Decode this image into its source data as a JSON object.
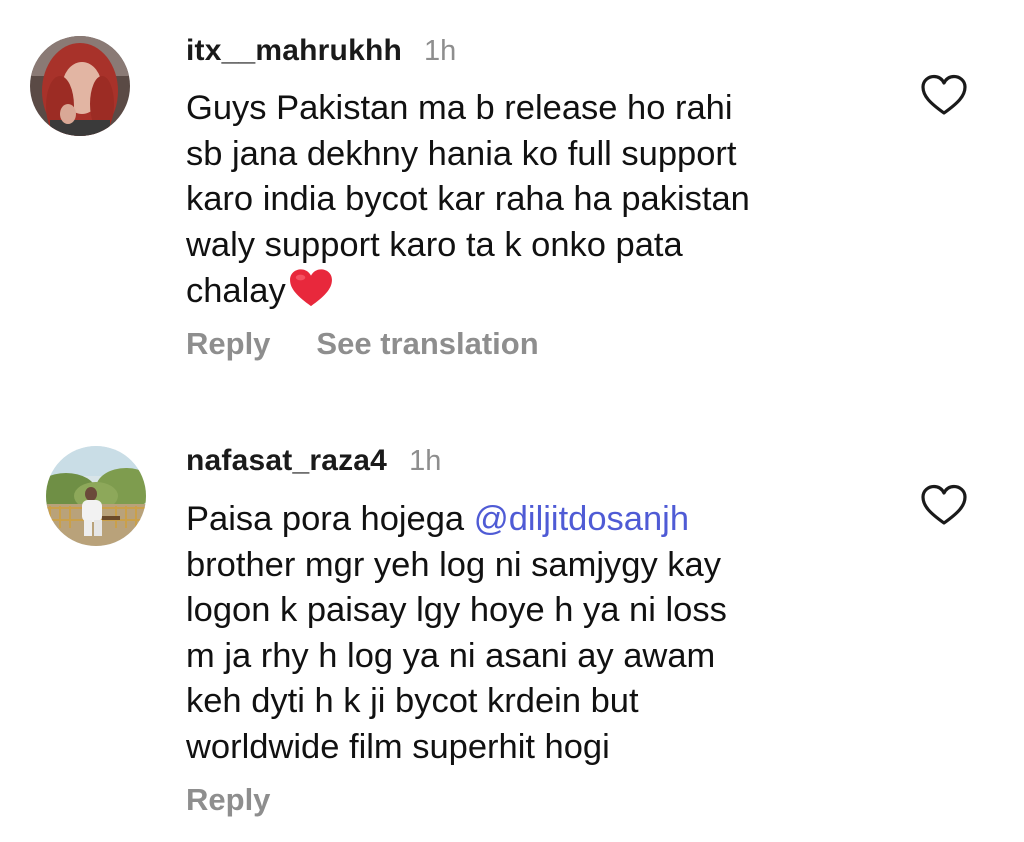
{
  "comments": [
    {
      "username": "itx__mahrukhh",
      "time": "1h",
      "lines": [
        "Guys Pakistan ma b release ho rahi",
        "sb jana dekhny hania ko full support",
        "karo india bycot kar raha ha pakistan",
        "waly support karo ta k onko pata",
        "chalay"
      ],
      "trailing_emoji": "red-heart",
      "actions": [
        "Reply",
        "See translation"
      ],
      "like_icon": "heart-outline-icon"
    },
    {
      "username": "nafasat_raza4",
      "time": "1h",
      "first_line_text": "Paisa pora hojega ",
      "mention": "@diljitdosanjh",
      "lines": [
        "brother mgr yeh log ni samjygy kay",
        "logon k paisay lgy hoye h ya ni loss",
        "m ja rhy h log ya ni asani ay awam",
        "keh dyti h k ji bycot krdein but",
        "worldwide film superhit hogi"
      ],
      "actions": [
        "Reply"
      ],
      "like_icon": "heart-outline-icon"
    }
  ],
  "colors": {
    "text": "#111111",
    "muted": "#8e8e8e",
    "mention": "#4f5bd5",
    "emoji_heart": "#e8283c"
  }
}
